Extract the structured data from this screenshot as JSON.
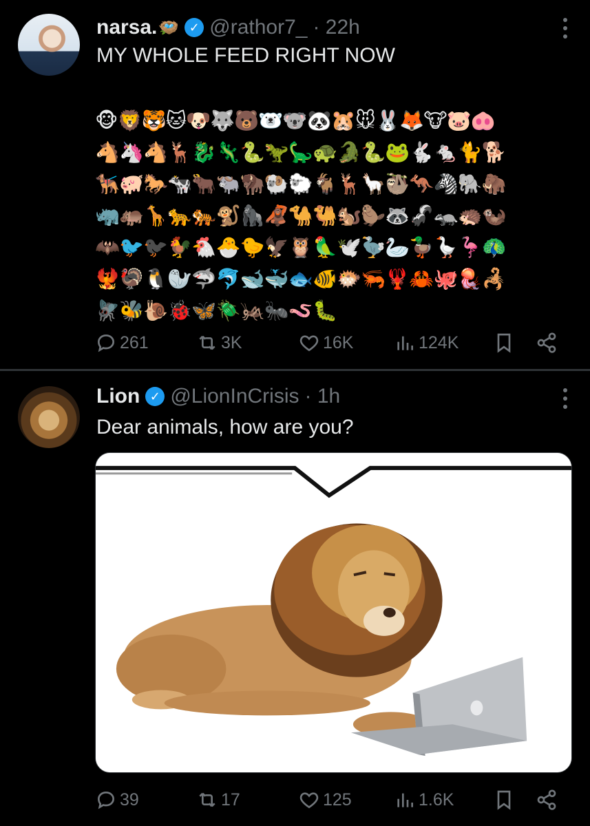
{
  "tweets": [
    {
      "display_name": "narsa.",
      "name_emoji": "🪺",
      "handle": "@rathor7_",
      "time": "· 22h",
      "text": "MY WHOLE FEED RIGHT NOW",
      "emoji_lines": [
        "🐵🦁🐯🐱🐶🐺🐻🐻‍❄️🐨🐼🐹🐭🐰🦊🐮🐷🐽",
        "🐴🦄🐴🦌🐉🦎🐍🦖🦕🐢🐊🐍🐸🐇🐁🐈🐕",
        "🐕‍🦺🐖🐎🐄🐂🐃🦬🐏🐑🐐🦌🦙🦥🦘🦓🐘🦣",
        "🦏🦛🦒🐆🐅🐒🦍🦧🐪🐫🐿️🦫🦝🦨🦡🦔🦦",
        "🦇🐦🐦‍⬛🐓🐔🐣🐤🦅🦉🦜🕊️🦤🦢🦆🪿🦩🦚",
        "🐦‍🔥🦃🐧🦭🦈🐬🐋🐳🐟🐠🐡🦐🦞🦀🐙🪼🦂",
        "🪰🐝🐌🐞🦋🪲🦗🐜🪱🐛"
      ],
      "stats": {
        "replies": "261",
        "reposts": "3K",
        "likes": "16K",
        "views": "124K"
      }
    },
    {
      "display_name": "Lion",
      "handle": "@LionInCrisis",
      "time": "· 1h",
      "text": "Dear animals, how are you?",
      "stats": {
        "replies": "39",
        "reposts": "17",
        "likes": "125",
        "views": "1.6K"
      }
    }
  ],
  "icons": {
    "reply": "reply-icon",
    "repost": "repost-icon",
    "like": "heart-icon",
    "views": "views-chart-icon",
    "bookmark": "bookmark-icon",
    "share": "share-icon",
    "verified": "verified-badge-icon",
    "more": "more-options-icon"
  },
  "colors": {
    "background": "#000000",
    "text": "#e7e9ea",
    "muted": "#71767b",
    "verified": "#1d9bf0",
    "divider": "#2f3336"
  }
}
